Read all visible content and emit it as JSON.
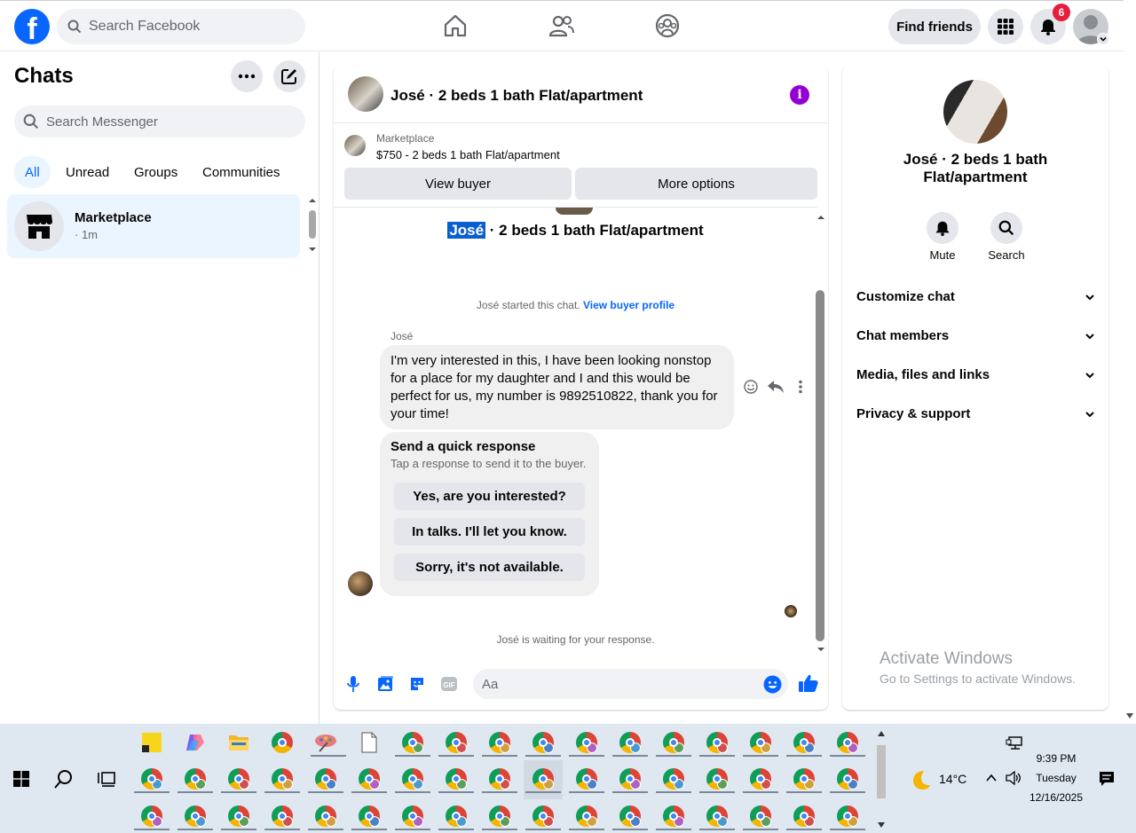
{
  "top_nav": {
    "search_placeholder": "Search Facebook",
    "find_friends": "Find friends",
    "notification_count": "6",
    "logo": "f"
  },
  "sidebar": {
    "title": "Chats",
    "search_placeholder": "Search Messenger",
    "filters": [
      "All",
      "Unread",
      "Groups",
      "Communities"
    ],
    "active_filter": "All",
    "chats": [
      {
        "name": "Marketplace",
        "time": "· 1m"
      }
    ]
  },
  "chat": {
    "header_title": "José · 2 beds 1 bath Flat/apartment",
    "marketplace_label": "Marketplace",
    "listing_price": "$750 - 2 beds 1 bath Flat/apartment",
    "view_buyer": "View buyer",
    "more_options": "More options",
    "listing_name_highlight": "José",
    "listing_title_rest": " · 2 beds 1 bath Flat/apartment",
    "started_text": "José started this chat. ",
    "view_buyer_profile": "View buyer profile",
    "sender": "José",
    "message": "I'm very interested in this, I have been looking nonstop for a place for my daughter and I and this would be perfect for us, my number is 9892510822, thank you for your time!",
    "quick_response_title": "Send a quick response",
    "quick_response_subtitle": "Tap a response to send it to the buyer.",
    "quick_responses": [
      "Yes, are you interested?",
      "In talks. I'll let you know.",
      "Sorry, it's not available."
    ],
    "waiting": "José is waiting for your response.",
    "composer_placeholder": "Aa"
  },
  "right_panel": {
    "name": "José · 2 beds 1 bath Flat/apartment",
    "mute": "Mute",
    "search": "Search",
    "sections": [
      "Customize chat",
      "Chat members",
      "Media, files and links",
      "Privacy & support"
    ]
  },
  "watermark": {
    "line1": "Activate Windows",
    "line2": "Go to Settings to activate Windows."
  },
  "taskbar": {
    "temperature": "14°C",
    "time": "9:39 PM",
    "day": "Tuesday",
    "date": "12/16/2025"
  },
  "colors": {
    "brand": "#0866ff",
    "badge": "#e41e3f",
    "info": "#9400d3"
  }
}
